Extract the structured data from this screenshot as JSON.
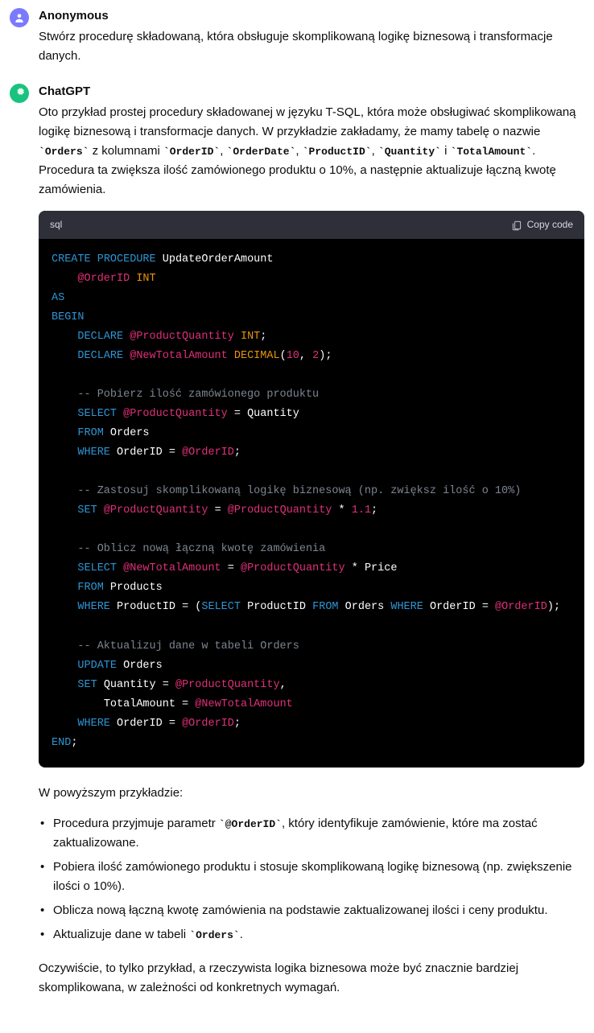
{
  "user": {
    "author": "Anonymous",
    "text": "Stwórz procedurę składowaną, która obsługuje skomplikowaną logikę biznesową i transformacje danych."
  },
  "assistant": {
    "author": "ChatGPT",
    "intro_parts": {
      "p1": "Oto przykład prostej procedury składowanej w języku T-SQL, która może obsługiwać skomplikowaną logikę biznesową i transformacje danych. W przykładzie zakładamy, że mamy tabelę o nazwie ",
      "c1": "Orders",
      "p2": " z kolumnami ",
      "c2": "OrderID",
      "p3": ", ",
      "c3": "OrderDate",
      "p4": ", ",
      "c4": "ProductID",
      "p5": ", ",
      "c5": "Quantity",
      "p6": " i ",
      "c6": "TotalAmount",
      "p7": ". Procedura ta zwiększa ilość zamówionego produktu o 10%, a następnie aktualizuje łączną kwotę zamówienia."
    },
    "code_lang": "sql",
    "copy_label": "Copy code",
    "after_code": "W powyższym przykładzie:",
    "bullets": {
      "b1a": "Procedura przyjmuje parametr ",
      "b1c": "@OrderID",
      "b1b": ", który identyfikuje zamówienie, które ma zostać zaktualizowane.",
      "b2": "Pobiera ilość zamówionego produktu i stosuje skomplikowaną logikę biznesową (np. zwiększenie ilości o 10%).",
      "b3": "Oblicza nową łączną kwotę zamówienia na podstawie zaktualizowanej ilości i ceny produktu.",
      "b4a": "Aktualizuje dane w tabeli ",
      "b4c": "Orders",
      "b4b": "."
    },
    "outro": "Oczywiście, to tylko przykład, a rzeczywista logika biznesowa może być znacznie bardziej skomplikowana, w zależności od konkretnych wymagań."
  },
  "code": {
    "l1_create": "CREATE",
    "l1_proc": "PROCEDURE",
    "l1_name": "UpdateOrderAmount",
    "l2_param": "@OrderID",
    "l2_type": "INT",
    "l3_as": "AS",
    "l4_begin": "BEGIN",
    "l5_declare": "DECLARE",
    "l5_var": "@ProductQuantity",
    "l5_type": "INT",
    "l6_declare": "DECLARE",
    "l6_var": "@NewTotalAmount",
    "l6_type": "DECIMAL",
    "l6_n1": "10",
    "l6_n2": "2",
    "c1": "-- Pobierz ilość zamówionego produktu",
    "l7_select": "SELECT",
    "l7_var": "@ProductQuantity",
    "l7_col": "Quantity",
    "l8_from": "FROM",
    "l8_tbl": "Orders",
    "l9_where": "WHERE",
    "l9_col": "OrderID",
    "l9_var": "@OrderID",
    "c2": "-- Zastosuj skomplikowaną logikę biznesową (np. zwiększ ilość o 10%)",
    "l10_set": "SET",
    "l10_var1": "@ProductQuantity",
    "l10_var2": "@ProductQuantity",
    "l10_num": "1.1",
    "c3": "-- Oblicz nową łączną kwotę zamówienia",
    "l11_select": "SELECT",
    "l11_var1": "@NewTotalAmount",
    "l11_var2": "@ProductQuantity",
    "l11_col": "Price",
    "l12_from": "FROM",
    "l12_tbl": "Products",
    "l13_where": "WHERE",
    "l13_col1": "ProductID",
    "l13_select": "SELECT",
    "l13_col2": "ProductID",
    "l13_from": "FROM",
    "l13_tbl": "Orders",
    "l13_where2": "WHERE",
    "l13_col3": "OrderID",
    "l13_var": "@OrderID",
    "c4": "-- Aktualizuj dane w tabeli Orders",
    "l14_update": "UPDATE",
    "l14_tbl": "Orders",
    "l15_set": "SET",
    "l15_col1": "Quantity",
    "l15_var1": "@ProductQuantity",
    "l16_col": "TotalAmount",
    "l16_var": "@NewTotalAmount",
    "l17_where": "WHERE",
    "l17_col": "OrderID",
    "l17_var": "@OrderID",
    "l18_end": "END"
  }
}
